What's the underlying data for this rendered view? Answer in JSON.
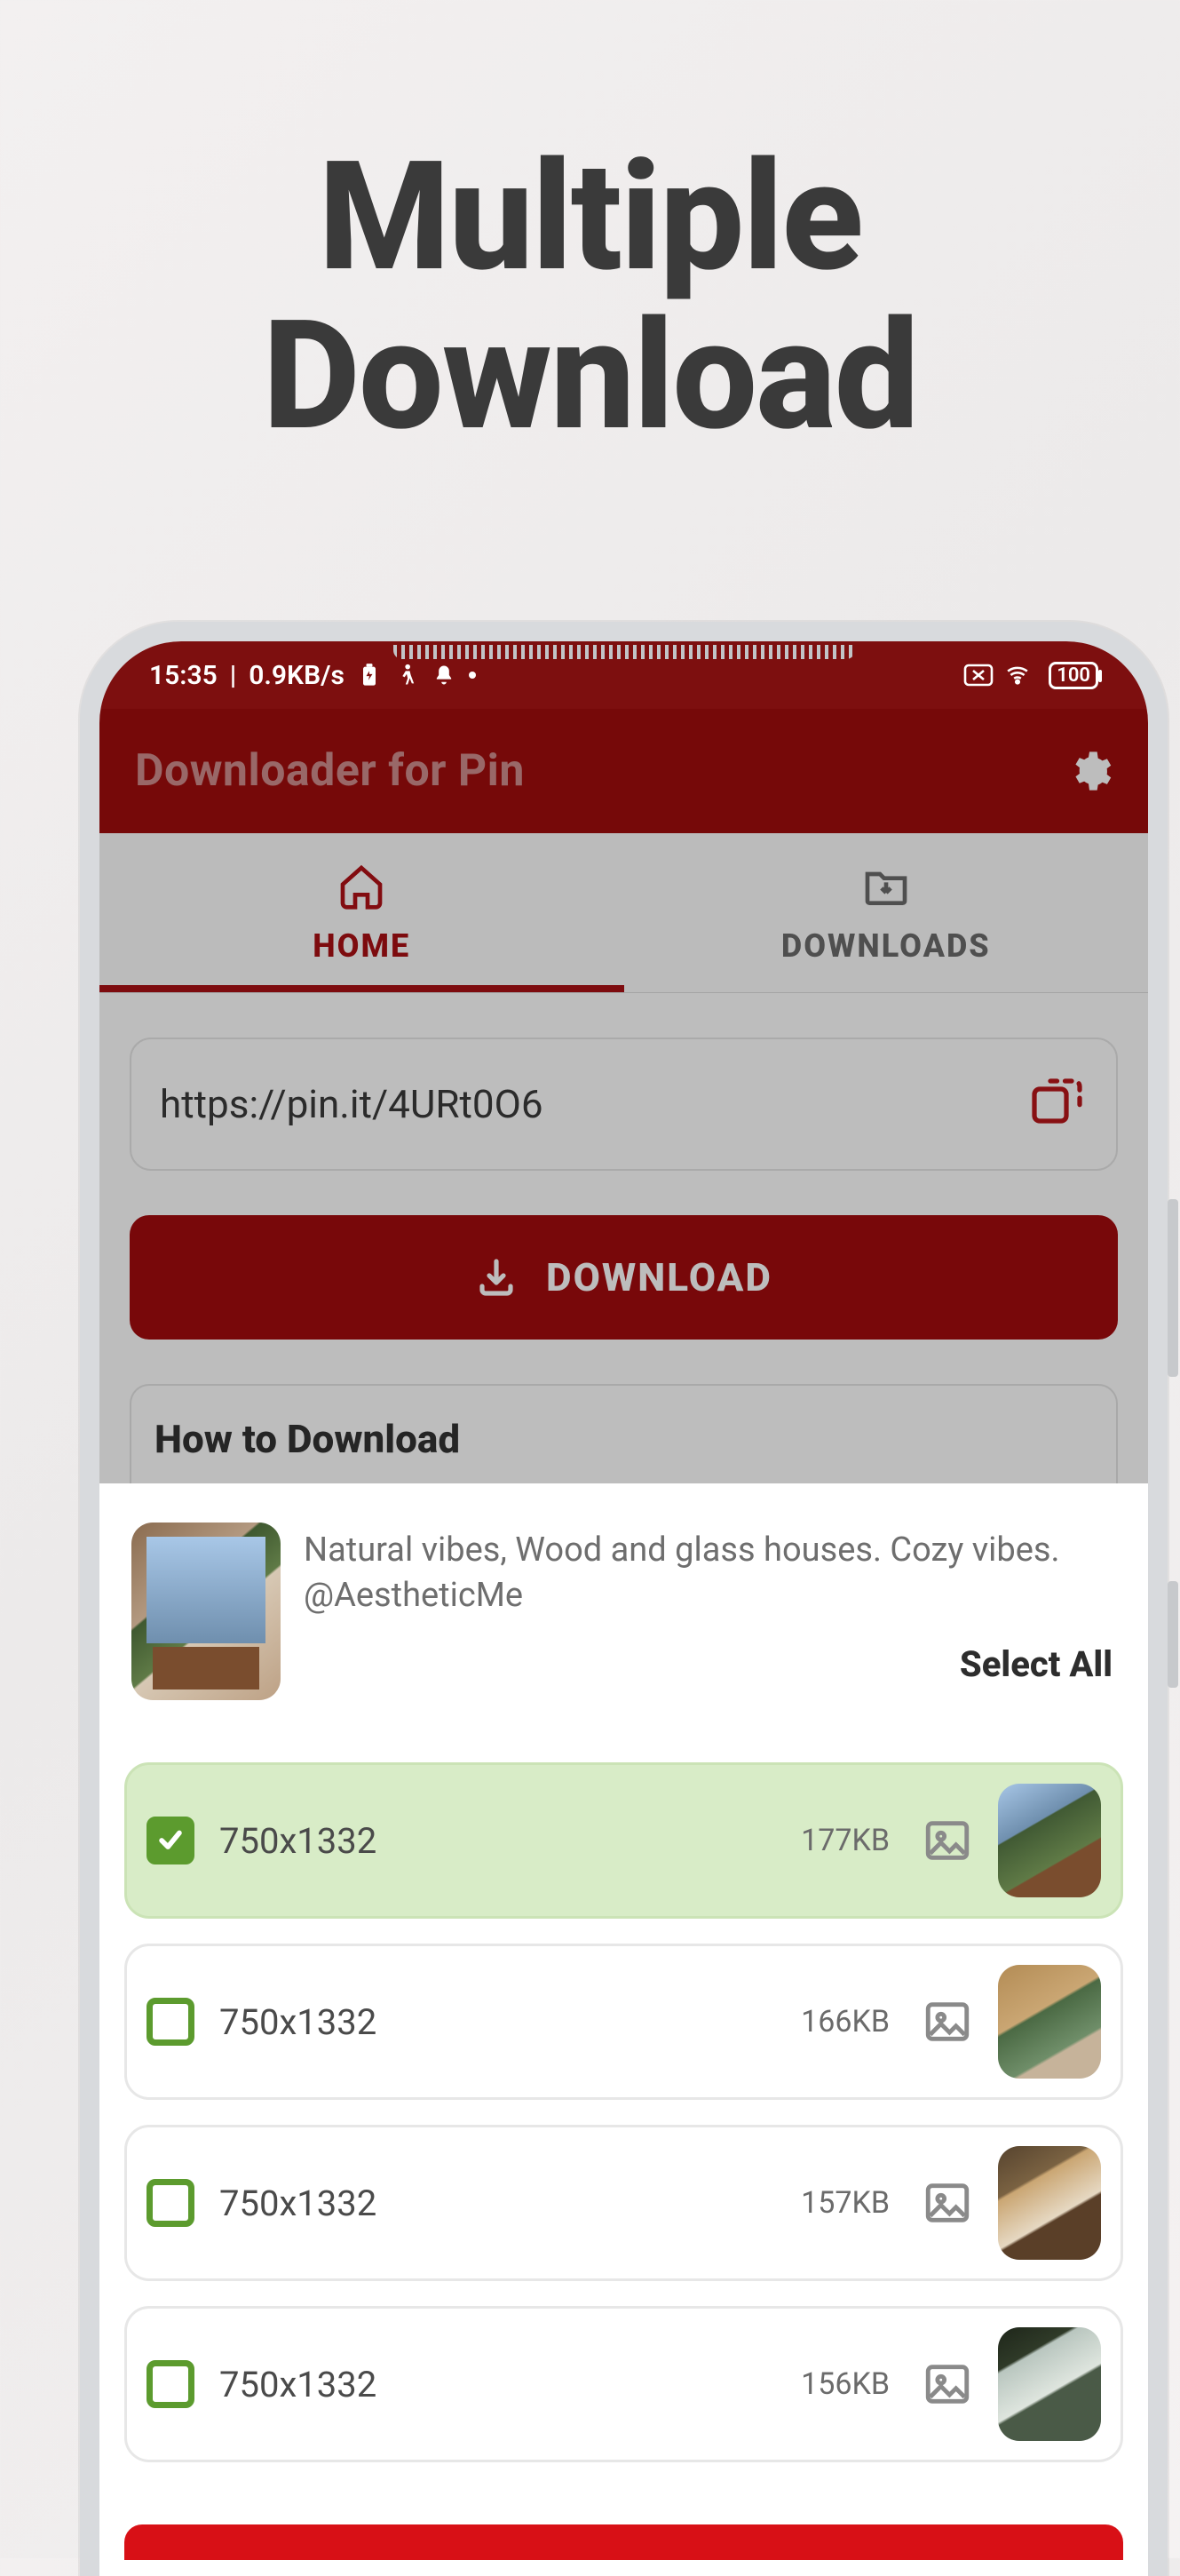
{
  "promo": {
    "line1": "Multiple",
    "line2": "Download"
  },
  "statusbar": {
    "time": "15:35",
    "net_rate": "0.9KB/s",
    "battery": "100"
  },
  "appbar": {
    "title": "Downloader for Pin"
  },
  "tabs": {
    "home": "HOME",
    "downloads": "DOWNLOADS",
    "active_index": 0
  },
  "url_input": {
    "value": "https://pin.it/4URt0O6"
  },
  "download_button": {
    "label": "DOWNLOAD"
  },
  "howto": {
    "title": "How to Download"
  },
  "sheet": {
    "description": "Natural vibes, Wood and glass houses. Cozy vibes. @AestheticMe",
    "select_all": "Select All",
    "items": [
      {
        "dimensions": "750x1332",
        "size": "177KB",
        "selected": true
      },
      {
        "dimensions": "750x1332",
        "size": "166KB",
        "selected": false
      },
      {
        "dimensions": "750x1332",
        "size": "157KB",
        "selected": false
      },
      {
        "dimensions": "750x1332",
        "size": "156KB",
        "selected": false
      }
    ]
  }
}
